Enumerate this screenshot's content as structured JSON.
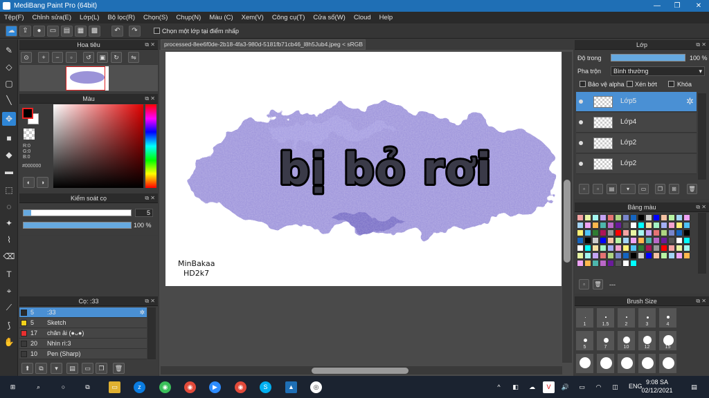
{
  "app": {
    "title": "MediBang Paint Pro (64bit)"
  },
  "window_controls": {
    "minimize": "—",
    "restore": "❐",
    "close": "✕"
  },
  "menu": [
    "Tệp(F)",
    "Chỉnh sửa(E)",
    "Lớp(L)",
    "Bộ lọc(R)",
    "Chọn(S)",
    "Chụp(N)",
    "Màu (C)",
    "Xem(V)",
    "Công cụ(T)",
    "Cửa sổ(W)",
    "Cloud",
    "Help"
  ],
  "toolbar": {
    "checkbox_label": "Chọn một lớp tại điểm nhấp"
  },
  "navigator": {
    "title": "Hoa tiêu"
  },
  "color_panel": {
    "title": "Màu",
    "r": "R:0",
    "g": "G:0",
    "b": "B:0",
    "hex": "#000000",
    "fg": "#000000",
    "bg": "#ffffff"
  },
  "brush_control": {
    "title": "Kiểm soát cọ",
    "size": "5",
    "opacity": "100 %",
    "size_fraction": 0.07,
    "opacity_fraction": 1.0
  },
  "brush_list": {
    "title": "Cọ: :33",
    "items": [
      {
        "num": "5",
        "name": ":33",
        "color": "#2a2a2a",
        "selected": true
      },
      {
        "num": "5",
        "name": "Sketch",
        "color": "#f2d21b"
      },
      {
        "num": "17",
        "name": "chân ải (●ᴗ●)",
        "color": "#e83030"
      },
      {
        "num": "20",
        "name": "Nhìn rì:3",
        "color": "#3a3a3a"
      },
      {
        "num": "10",
        "name": "Pen (Sharp)",
        "color": "#3a3a3a"
      }
    ]
  },
  "document_tab": {
    "label": "processed-8ee6f0de-2b18-4fa3-980d-5181fb71cb46_l8h5Jub4.jpeg < sRGB >"
  },
  "canvas": {
    "main_text": "bị bỏ rơi",
    "signature_line1": "MinBakaa",
    "signature_line2": "HD2k7"
  },
  "layer_panel": {
    "title": "Lớp",
    "opacity_label": "Độ trong",
    "opacity_value": "100 %",
    "opacity_fraction": 1.0,
    "blend_label": "Pha trộn",
    "blend_value": "Bình thường",
    "check_alpha": "Bảo vệ alpha",
    "check_clip": "Xén bớt",
    "check_lock": "Khóa",
    "layers": [
      {
        "name": "Lớp5",
        "selected": true
      },
      {
        "name": "Lớp4"
      },
      {
        "name": "Lớp2"
      },
      {
        "name": "Lớp2"
      }
    ]
  },
  "palette_panel": {
    "title": "Bảng màu",
    "dash": "---"
  },
  "brush_size_panel": {
    "title": "Brush Size",
    "labels_row1": [
      "1",
      "1.5",
      "2",
      "3",
      "4"
    ],
    "labels_row2": [
      "5",
      "7",
      "10",
      "12",
      "15"
    ]
  },
  "taskbar": {
    "lang": "ENG",
    "time": "9:08 SA",
    "date": "02/12/2021"
  },
  "colors": {
    "accent": "#4a90d4",
    "title_bar": "#1f6fb5",
    "paint_purple": "#8f85d6"
  }
}
